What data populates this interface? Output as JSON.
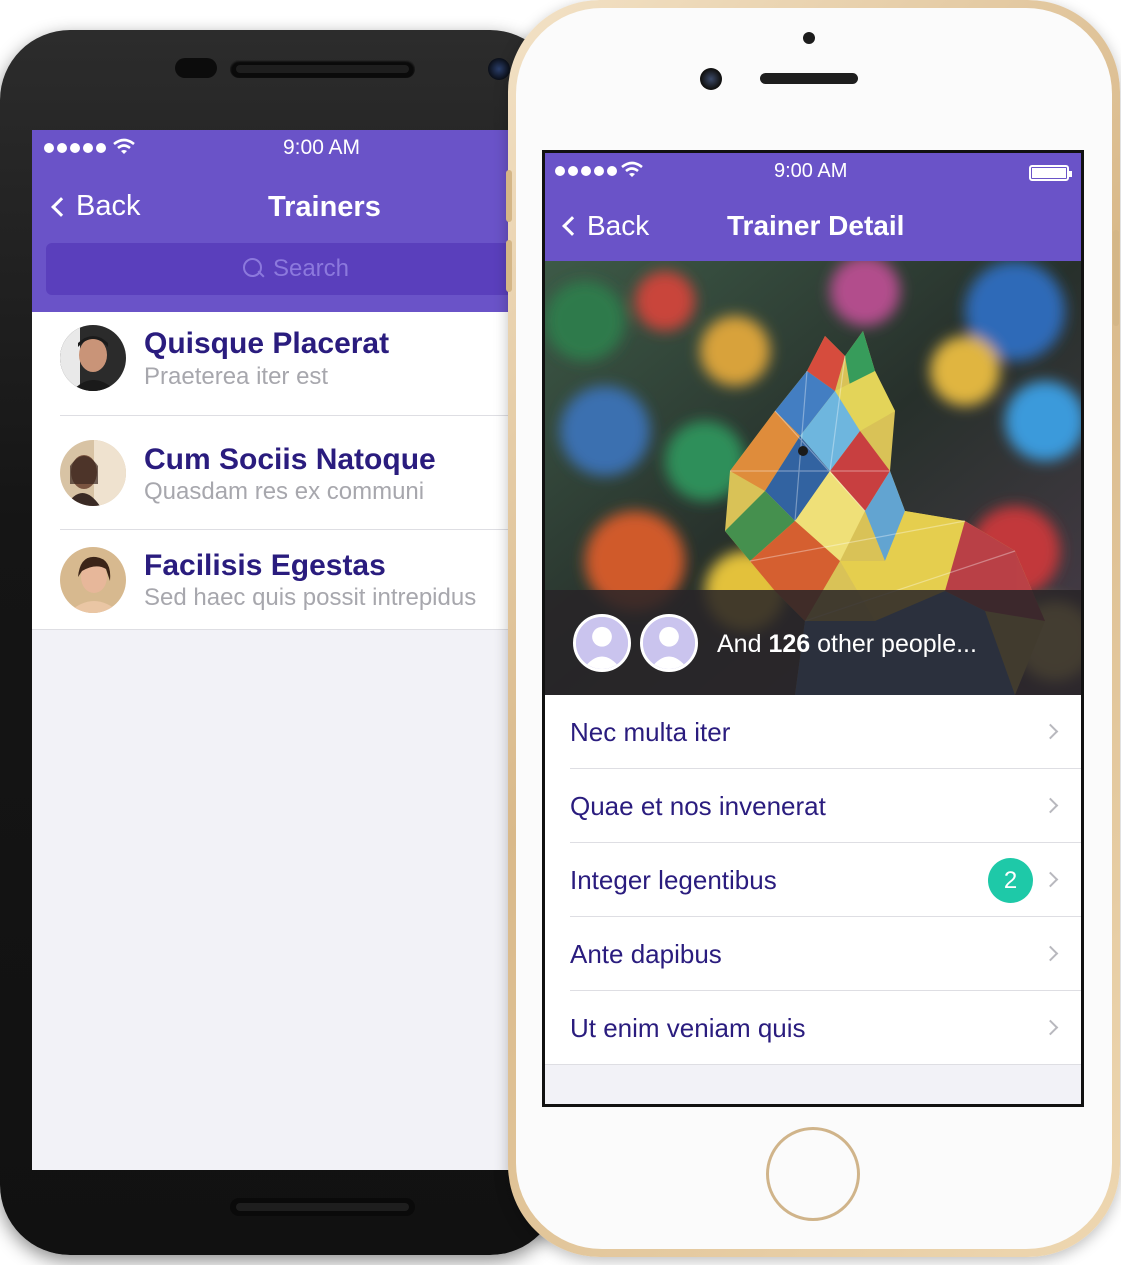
{
  "android": {
    "status": {
      "time": "9:00 AM"
    },
    "nav": {
      "back_label": "Back",
      "title": "Trainers"
    },
    "search": {
      "placeholder": "Search"
    },
    "trainers": [
      {
        "name": "Quisque Placerat",
        "subtitle": "Praeterea iter est"
      },
      {
        "name": "Cum Sociis Natoque",
        "subtitle": "Quasdam res ex communi"
      },
      {
        "name": "Facilisis Egestas",
        "subtitle": "Sed haec quis possit intrepidus"
      }
    ]
  },
  "iphone": {
    "status": {
      "time": "9:00 AM"
    },
    "nav": {
      "back_label": "Back",
      "title": "Trainer Detail"
    },
    "people": {
      "prefix": "And",
      "count": "126",
      "suffix": "other people..."
    },
    "menu": [
      {
        "label": "Nec multa iter"
      },
      {
        "label": "Quae et nos invenerat"
      },
      {
        "label": "Integer legentibus",
        "badge": "2"
      },
      {
        "label": "Ante dapibus"
      },
      {
        "label": "Ut enim  veniam quis"
      }
    ]
  },
  "colors": {
    "accent": "#6a53c8",
    "text_primary": "#2a1c7e",
    "badge": "#1ec9a8"
  }
}
